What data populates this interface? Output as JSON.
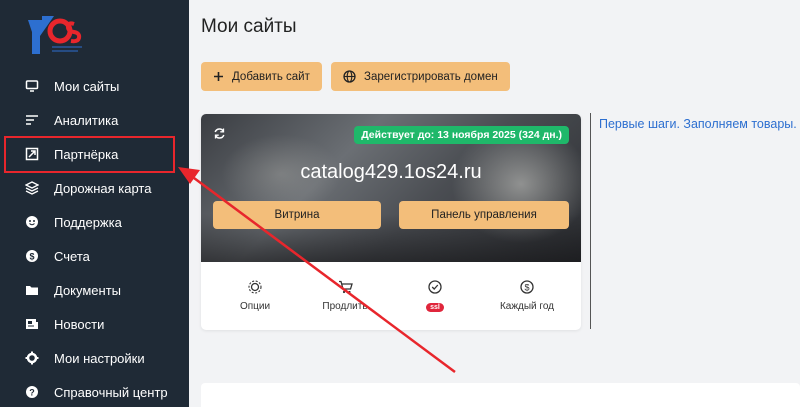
{
  "sidebar": {
    "logo_text": "10S",
    "items": [
      {
        "label": "Мои сайты",
        "icon": "monitor-icon"
      },
      {
        "label": "Аналитика",
        "icon": "analytics-icon"
      },
      {
        "label": "Партнёрка",
        "icon": "partner-icon"
      },
      {
        "label": "Дорожная карта",
        "icon": "layers-icon"
      },
      {
        "label": "Поддержка",
        "icon": "support-icon"
      },
      {
        "label": "Счета",
        "icon": "dollar-icon"
      },
      {
        "label": "Документы",
        "icon": "folder-icon"
      },
      {
        "label": "Новости",
        "icon": "news-icon"
      },
      {
        "label": "Мои настройки",
        "icon": "gear-icon"
      },
      {
        "label": "Справочный центр",
        "icon": "help-icon"
      }
    ]
  },
  "main": {
    "title": "Мои сайты",
    "add_site_label": "Добавить сайт",
    "register_domain_label": "Зарегистрировать домен",
    "site_card": {
      "badge": "Действует до: 13 ноября 2025 (324 дн.)",
      "domain": "catalog429.1os24.ru",
      "storefront_label": "Витрина",
      "control_panel_label": "Панель управления",
      "actions": [
        {
          "label": "Опции",
          "icon": "gear-icon"
        },
        {
          "label": "Продлить",
          "icon": "cart-icon"
        },
        {
          "label": "ssl",
          "icon": "check-circle-icon"
        },
        {
          "label": "Каждый год",
          "icon": "dollar-icon"
        }
      ]
    },
    "first_steps_link": "Первые шаги. Заполняем товары."
  },
  "colors": {
    "sidebar_bg": "#1f2a36",
    "accent_button": "#f3be7a",
    "badge_green": "#1fb86a",
    "link_blue": "#2d6fd0",
    "annotation_red": "#e8262c"
  }
}
